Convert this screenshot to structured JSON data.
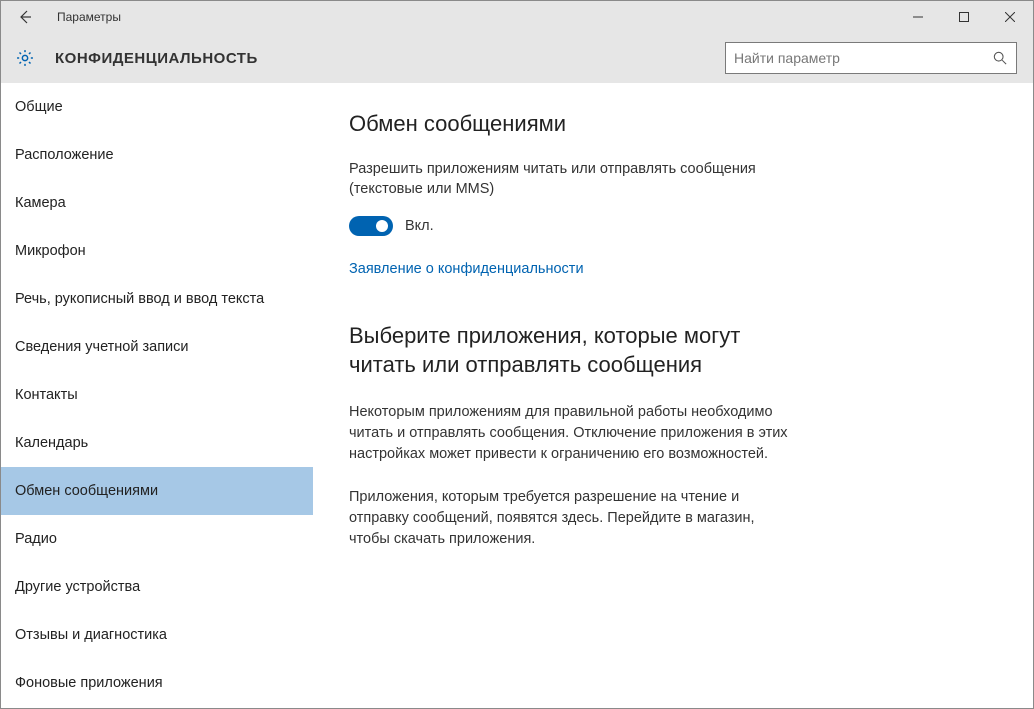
{
  "window": {
    "title": "Параметры"
  },
  "header": {
    "page_title": "КОНФИДЕНЦИАЛЬНОСТЬ",
    "search_placeholder": "Найти параметр"
  },
  "sidebar": {
    "items": [
      {
        "label": "Общие",
        "selected": false
      },
      {
        "label": "Расположение",
        "selected": false
      },
      {
        "label": "Камера",
        "selected": false
      },
      {
        "label": "Микрофон",
        "selected": false
      },
      {
        "label": "Речь, рукописный ввод и ввод текста",
        "selected": false
      },
      {
        "label": "Сведения учетной записи",
        "selected": false
      },
      {
        "label": "Контакты",
        "selected": false
      },
      {
        "label": "Календарь",
        "selected": false
      },
      {
        "label": "Обмен сообщениями",
        "selected": true
      },
      {
        "label": "Радио",
        "selected": false
      },
      {
        "label": "Другие устройства",
        "selected": false
      },
      {
        "label": "Отзывы и диагностика",
        "selected": false
      },
      {
        "label": "Фоновые приложения",
        "selected": false
      }
    ]
  },
  "main": {
    "heading1": "Обмен сообщениями",
    "description": "Разрешить приложениям читать или отправлять сообщения (текстовые или MMS)",
    "toggle": {
      "label": "Вкл.",
      "state": "on"
    },
    "privacy_link": "Заявление о конфиденциальности",
    "heading2": "Выберите приложения, которые могут читать или отправлять сообщения",
    "para1": "Некоторым приложениям для правильной работы необходимо читать и отправлять сообщения. Отключение приложения в этих настройках может привести к ограничению его возможностей.",
    "para2": "Приложения, которым требуется разрешение на чтение и отправку сообщений, появятся здесь. Перейдите в магазин, чтобы скачать приложения."
  }
}
